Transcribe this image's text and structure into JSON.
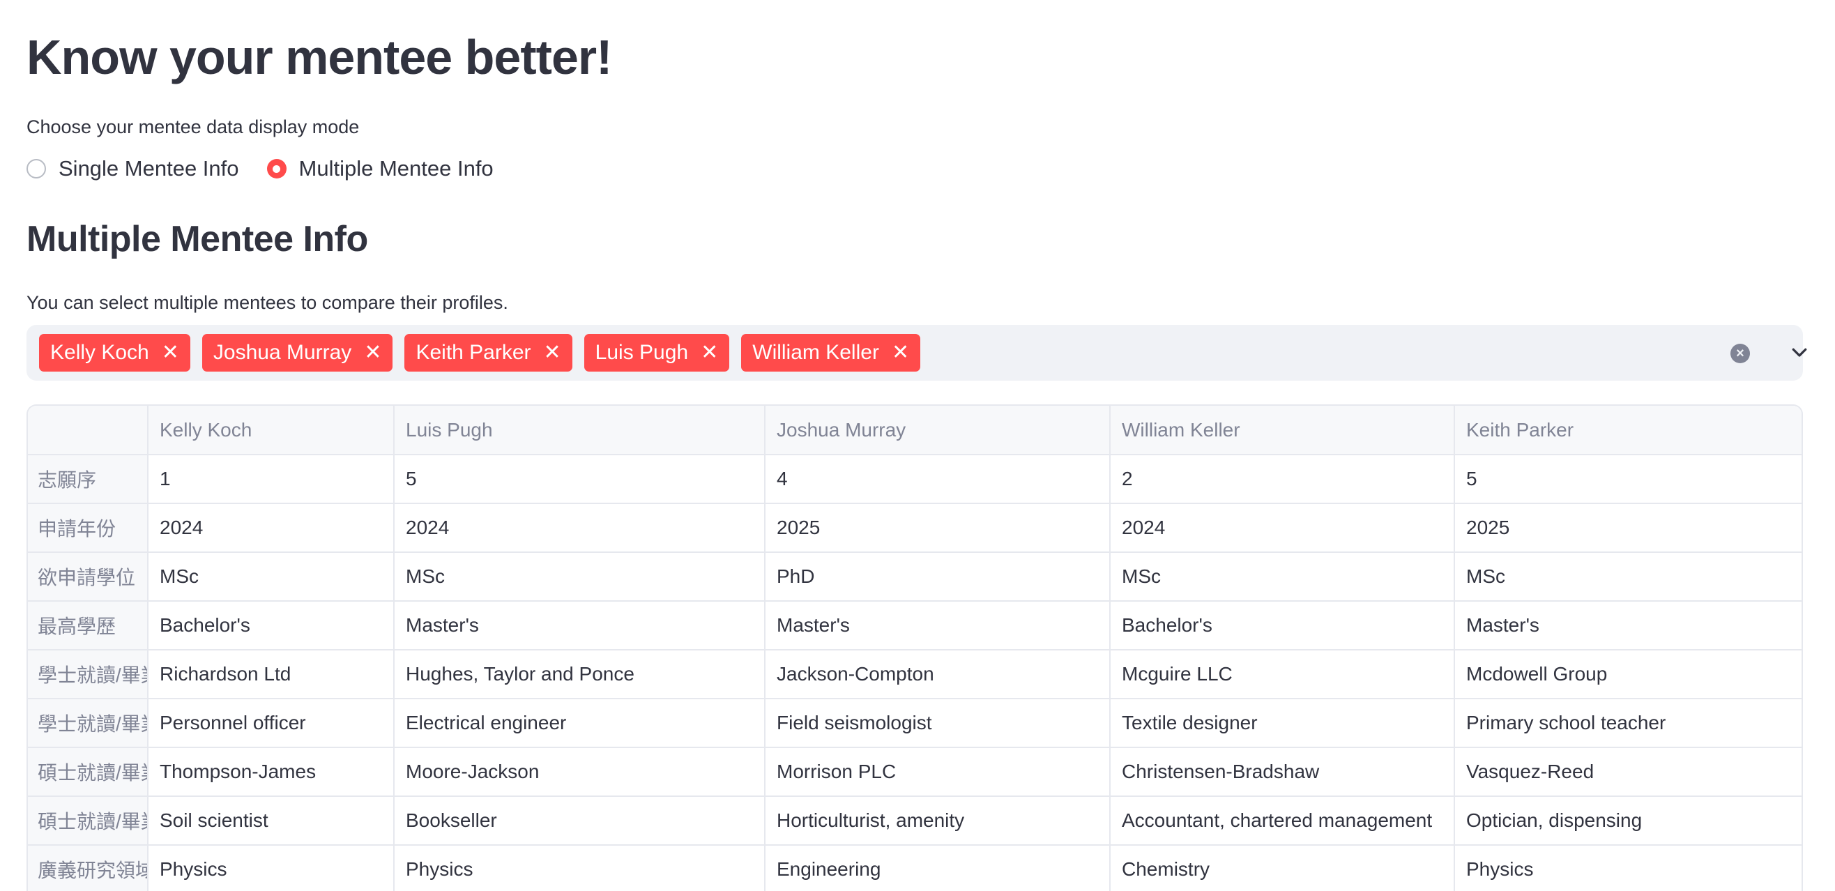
{
  "title": "Know your mentee better!",
  "display_mode": {
    "label": "Choose your mentee data display mode",
    "options": [
      "Single Mentee Info",
      "Multiple Mentee Info"
    ],
    "selected": "Multiple Mentee Info"
  },
  "section": {
    "title": "Multiple Mentee Info",
    "select_label": "You can select multiple mentees to compare their profiles."
  },
  "multiselect": {
    "selected_tags": [
      "Kelly Koch",
      "Joshua Murray",
      "Keith Parker",
      "Luis Pugh",
      "William Keller"
    ],
    "tag_remove_glyph": "✕",
    "clear_icon": "clear-circle-icon",
    "expand_icon": "chevron-down-icon"
  },
  "table": {
    "corner": "",
    "columns": [
      "Kelly Koch",
      "Luis Pugh",
      "Joshua Murray",
      "William Keller",
      "Keith Parker"
    ],
    "rows": [
      {
        "label": "志願序",
        "cells": [
          "1",
          "5",
          "4",
          "2",
          "5"
        ]
      },
      {
        "label": "申請年份",
        "cells": [
          "2024",
          "2024",
          "2025",
          "2024",
          "2025"
        ]
      },
      {
        "label": "欲申請學位",
        "cells": [
          "MSc",
          "MSc",
          "PhD",
          "MSc",
          "MSc"
        ]
      },
      {
        "label": "最高學歷",
        "cells": [
          "Bachelor's",
          "Master's",
          "Master's",
          "Bachelor's",
          "Master's"
        ]
      },
      {
        "label": "學士就讀/畢業",
        "cells": [
          "Richardson Ltd",
          "Hughes, Taylor and Ponce",
          "Jackson-Compton",
          "Mcguire LLC",
          "Mcdowell Group"
        ]
      },
      {
        "label": "學士就讀/畢業",
        "cells": [
          "Personnel officer",
          "Electrical engineer",
          "Field seismologist",
          "Textile designer",
          "Primary school teacher"
        ]
      },
      {
        "label": "碩士就讀/畢業",
        "cells": [
          "Thompson-James",
          "Moore-Jackson",
          "Morrison PLC",
          "Christensen-Bradshaw",
          "Vasquez-Reed"
        ]
      },
      {
        "label": "碩士就讀/畢業",
        "cells": [
          "Soil scientist",
          "Bookseller",
          "Horticulturist, amenity",
          "Accountant, chartered management",
          "Optician, dispensing"
        ]
      },
      {
        "label": "廣義研究領域",
        "cells": [
          "Physics",
          "Physics",
          "Engineering",
          "Chemistry",
          "Physics"
        ]
      }
    ]
  },
  "colors": {
    "accent": "#ff4b4b",
    "text": "#31333f",
    "muted_text": "#808495",
    "input_background": "#f0f2f6",
    "table_border": "#e6e8ee"
  }
}
